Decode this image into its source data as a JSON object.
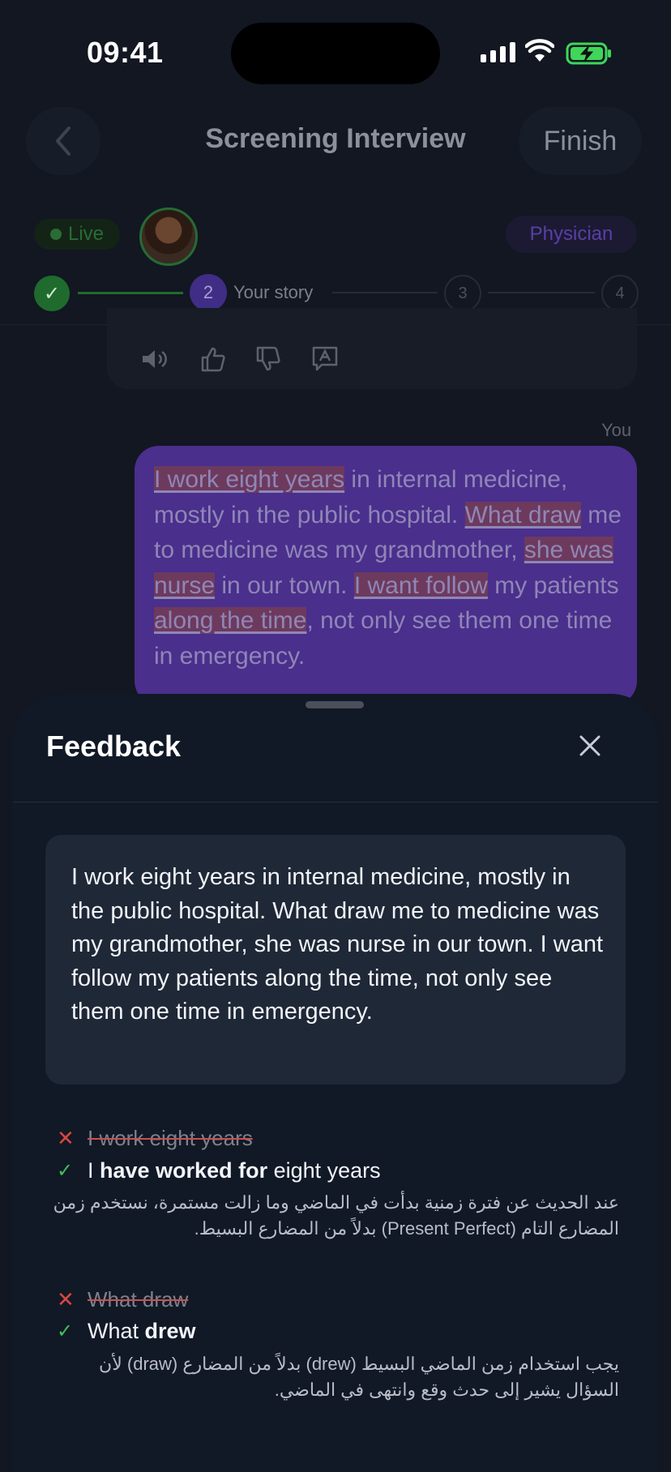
{
  "status_bar": {
    "time": "09:41"
  },
  "header": {
    "title": "Screening Interview",
    "finish_label": "Finish"
  },
  "session": {
    "live_label": "Live",
    "role_label": "Physician"
  },
  "steps": {
    "done_mark": "✓",
    "current_number": "2",
    "current_label": "Your story",
    "step3": "3",
    "step4": "4"
  },
  "chat": {
    "sender_label": "You",
    "message_segments": [
      {
        "text": "I work eight years",
        "error": true
      },
      {
        "text": " in internal medicine, mostly in the public hospital. ",
        "error": false
      },
      {
        "text": "What draw",
        "error": true
      },
      {
        "text": " me to medicine was my grandmother, ",
        "error": false
      },
      {
        "text": "she was nurse",
        "error": true
      },
      {
        "text": " in our town. ",
        "error": false
      },
      {
        "text": "I want follow",
        "error": true
      },
      {
        "text": " my patients ",
        "error": false
      },
      {
        "text": "along the time",
        "error": true
      },
      {
        "text": ", not only see them one time in emergency.",
        "error": false
      }
    ]
  },
  "feedback": {
    "title": "Feedback",
    "original_text": "I work eight years in internal medicine, mostly in the public hospital. What draw me to medicine was my grandmother, she was nurse in our town. I want follow my patients along the time, not only see them one time in emergency.",
    "corrections": [
      {
        "wrong": "I work eight years",
        "right_prefix": "I ",
        "right_bold": "have worked for",
        "right_suffix": " eight years",
        "explanation": "عند الحديث عن فترة زمنية بدأت في الماضي وما زالت مستمرة، نستخدم زمن المضارع التام (Present Perfect) بدلاً من المضارع البسيط."
      },
      {
        "wrong": "What draw",
        "right_prefix": "What ",
        "right_bold": "drew",
        "right_suffix": "",
        "explanation": "يجب استخدام زمن الماضي البسيط (drew) بدلاً من المضارع (draw) لأن السؤال يشير إلى حدث وقع وانتهى في الماضي."
      }
    ]
  },
  "colors": {
    "accent_purple": "#4a2f8c",
    "live_green": "#1f6b2d",
    "error_red": "#d9473f",
    "ok_green": "#3fbf5a"
  }
}
